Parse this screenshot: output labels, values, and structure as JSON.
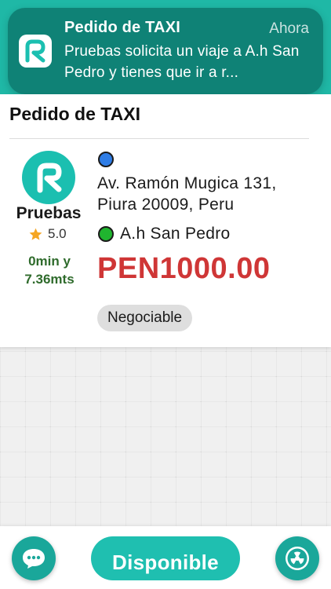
{
  "notification": {
    "title": "Pedido de TAXI",
    "time": "Ahora",
    "body": "Pruebas solicita un viaje a A.h San Pedro y tienes que ir a r...",
    "app_icon": "app-logo-icon"
  },
  "order": {
    "title": "Pedido de TAXI",
    "user": {
      "name": "Pruebas",
      "rating": "5.0",
      "eta": "0min y\n7.36mts"
    },
    "origin": "Av. Ramón Mugica 131, Piura 20009, Peru",
    "destination": "A.h San Pedro",
    "price": "PEN1000.00",
    "badge": "Negociable"
  },
  "bottom": {
    "available_label": "Disponible",
    "chat_icon": "chat-icon",
    "radio_icon": "radiation-icon"
  },
  "colors": {
    "brand": "#1fbfb0",
    "notification_bg": "#0e7e72",
    "price": "#cf3636",
    "eta": "#2f6b2c",
    "origin_dot": "#2f7de6",
    "destination_dot": "#20b52f"
  }
}
